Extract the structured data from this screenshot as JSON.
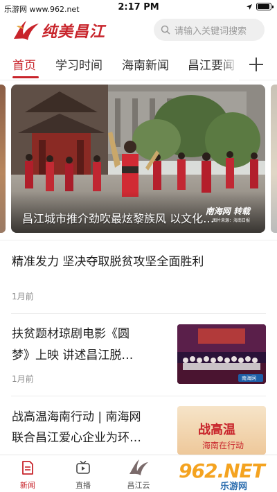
{
  "status_bar": {
    "carrier": "乐游网 www.962.net",
    "time": "2:17 PM"
  },
  "header": {
    "logo_text": "纯美昌江",
    "search_placeholder": "请输入关键词搜索"
  },
  "tabs": [
    {
      "label": "首页",
      "active": true
    },
    {
      "label": "学习时间",
      "active": false
    },
    {
      "label": "海南新闻",
      "active": false
    },
    {
      "label": "昌江要闻",
      "active": false
    }
  ],
  "carousel": {
    "caption": "昌江城市推介劲吹最炫黎族风 以文化…",
    "watermark": "南海网",
    "watermark_suffix": "转载",
    "watermark_sub": "图片来源：海南日报"
  },
  "news": [
    {
      "title": "精准发力 坚决夺取脱贫攻坚全面胜利",
      "time": "1月前"
    },
    {
      "title_lines": [
        "扶贫题材琼剧电影《圆",
        "梦》上映 讲述昌江脱…"
      ],
      "time": "1月前",
      "thumb_tag": "南海网"
    },
    {
      "title_lines": [
        "战高温海南行动 | 南海网",
        "联合昌江爱心企业为环…"
      ],
      "thumb_text": [
        "战高温",
        "海南在行动"
      ]
    }
  ],
  "bottom_nav": [
    {
      "label": "新闻",
      "active": true,
      "icon": "news-document-icon"
    },
    {
      "label": "直播",
      "active": false,
      "icon": "tv-icon"
    },
    {
      "label": "昌江云",
      "active": false,
      "icon": "changjiang-cloud-logo-icon"
    }
  ],
  "overlay_watermark": {
    "brand": "962.NET",
    "cn": "乐游网"
  },
  "colors": {
    "accent": "#c8242b",
    "search_bg": "#efefef"
  }
}
